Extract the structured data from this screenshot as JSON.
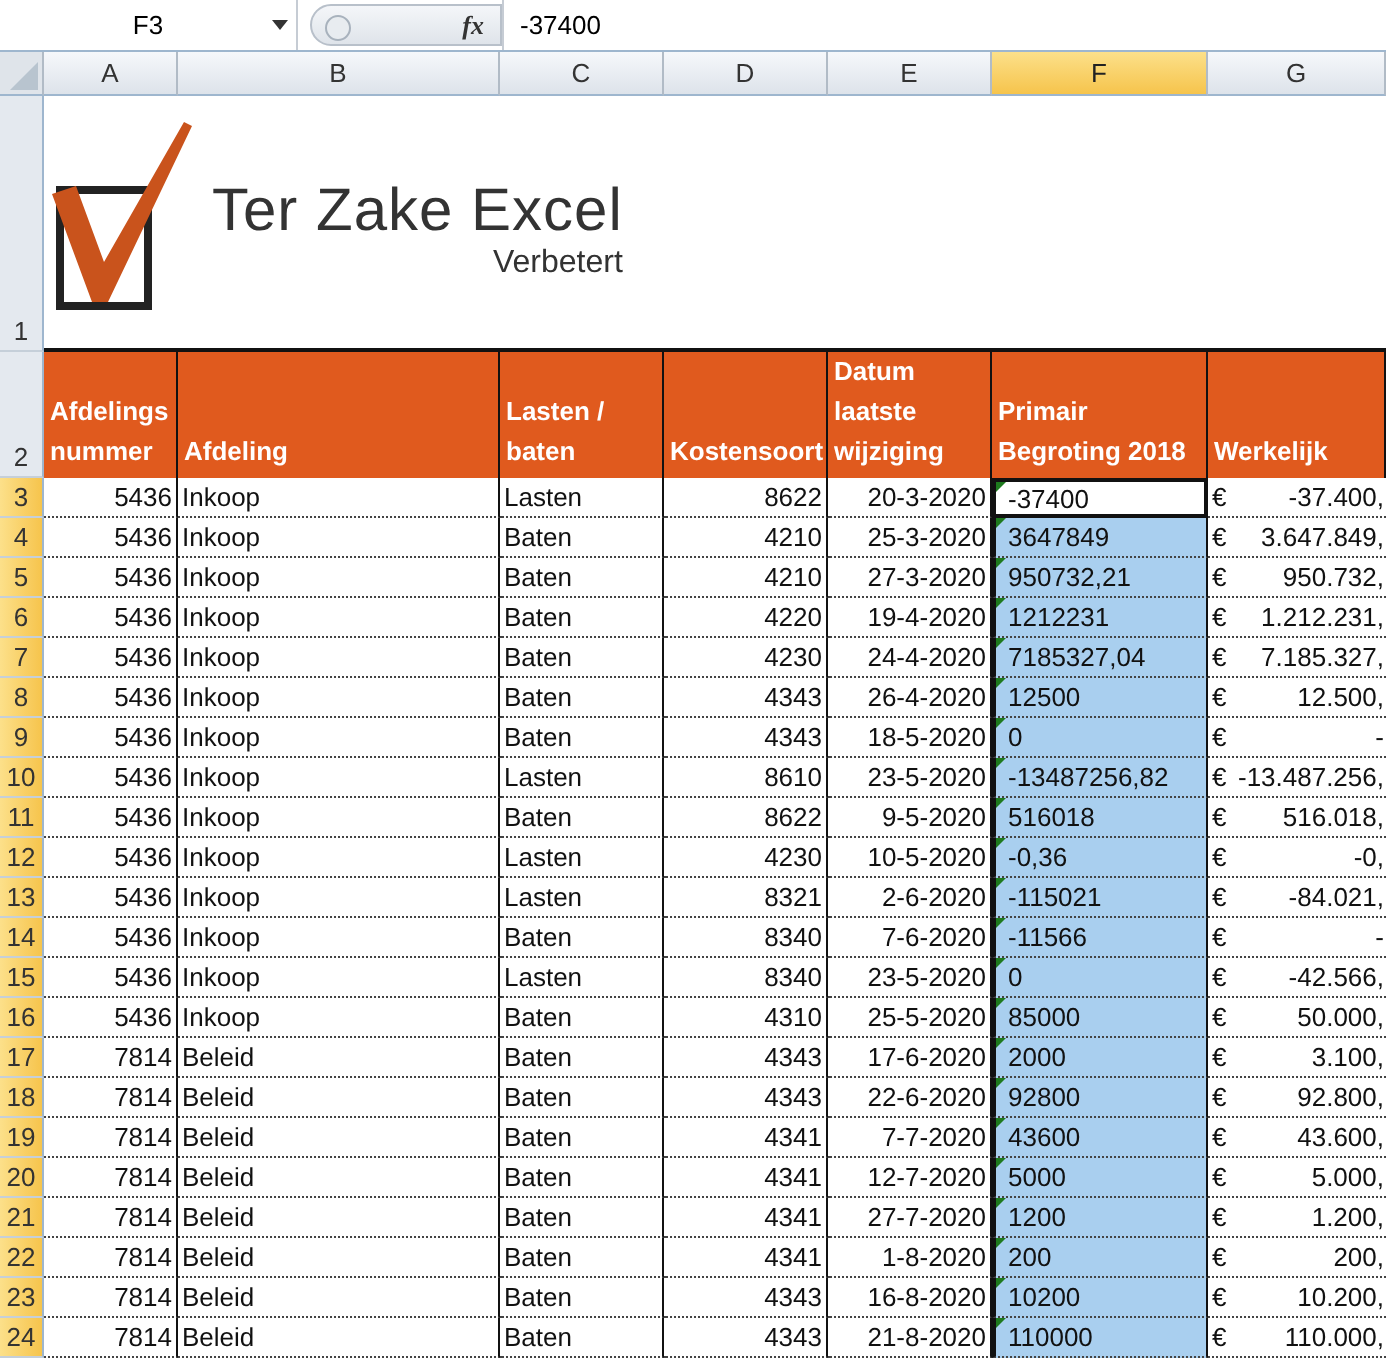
{
  "formula_bar": {
    "name_box": "F3",
    "fx": "fx",
    "formula": "-37400"
  },
  "columns": [
    {
      "label": "A",
      "selected": false
    },
    {
      "label": "B",
      "selected": false
    },
    {
      "label": "C",
      "selected": false
    },
    {
      "label": "D",
      "selected": false
    },
    {
      "label": "E",
      "selected": false
    },
    {
      "label": "F",
      "selected": true
    },
    {
      "label": "G",
      "selected": false
    }
  ],
  "logo_row": {
    "number": "1",
    "selected": false,
    "title": "Ter Zake Excel",
    "subtitle": "Verbetert"
  },
  "header_row": {
    "number": "2",
    "selected": false,
    "cells": [
      "Afdelings nummer",
      "Afdeling",
      "Lasten / baten",
      "Kostensoort",
      "Datum laatste wijziging",
      "Primair Begroting 2018",
      "Werkelijk"
    ]
  },
  "rows": [
    {
      "number": "3",
      "selected": true,
      "active": true,
      "cells": [
        "5436",
        "Inkoop",
        "Lasten",
        "8622",
        "20-3-2020",
        "-37400"
      ],
      "currency": "€",
      "amount": "-37.400,"
    },
    {
      "number": "4",
      "selected": true,
      "active": false,
      "cells": [
        "5436",
        "Inkoop",
        "Baten",
        "4210",
        "25-3-2020",
        "3647849"
      ],
      "currency": "€",
      "amount": "3.647.849,"
    },
    {
      "number": "5",
      "selected": true,
      "active": false,
      "cells": [
        "5436",
        "Inkoop",
        "Baten",
        "4210",
        "27-3-2020",
        "950732,21"
      ],
      "currency": "€",
      "amount": "950.732,"
    },
    {
      "number": "6",
      "selected": true,
      "active": false,
      "cells": [
        "5436",
        "Inkoop",
        "Baten",
        "4220",
        "19-4-2020",
        "1212231"
      ],
      "currency": "€",
      "amount": "1.212.231,"
    },
    {
      "number": "7",
      "selected": true,
      "active": false,
      "cells": [
        "5436",
        "Inkoop",
        "Baten",
        "4230",
        "24-4-2020",
        "7185327,04"
      ],
      "currency": "€",
      "amount": "7.185.327,"
    },
    {
      "number": "8",
      "selected": true,
      "active": false,
      "cells": [
        "5436",
        "Inkoop",
        "Baten",
        "4343",
        "26-4-2020",
        "12500"
      ],
      "currency": "€",
      "amount": "12.500,"
    },
    {
      "number": "9",
      "selected": true,
      "active": false,
      "cells": [
        "5436",
        "Inkoop",
        "Baten",
        "4343",
        "18-5-2020",
        "0"
      ],
      "currency": "€",
      "amount": "-"
    },
    {
      "number": "10",
      "selected": true,
      "active": false,
      "cells": [
        "5436",
        "Inkoop",
        "Lasten",
        "8610",
        "23-5-2020",
        "-13487256,82"
      ],
      "currency": "€",
      "amount": "-13.487.256,"
    },
    {
      "number": "11",
      "selected": true,
      "active": false,
      "cells": [
        "5436",
        "Inkoop",
        "Baten",
        "8622",
        "9-5-2020",
        "516018"
      ],
      "currency": "€",
      "amount": "516.018,"
    },
    {
      "number": "12",
      "selected": true,
      "active": false,
      "cells": [
        "5436",
        "Inkoop",
        "Lasten",
        "4230",
        "10-5-2020",
        "-0,36"
      ],
      "currency": "€",
      "amount": "-0,"
    },
    {
      "number": "13",
      "selected": true,
      "active": false,
      "cells": [
        "5436",
        "Inkoop",
        "Lasten",
        "8321",
        "2-6-2020",
        "-115021"
      ],
      "currency": "€",
      "amount": "-84.021,"
    },
    {
      "number": "14",
      "selected": true,
      "active": false,
      "cells": [
        "5436",
        "Inkoop",
        "Baten",
        "8340",
        "7-6-2020",
        "-11566"
      ],
      "currency": "€",
      "amount": "-"
    },
    {
      "number": "15",
      "selected": true,
      "active": false,
      "cells": [
        "5436",
        "Inkoop",
        "Lasten",
        "8340",
        "23-5-2020",
        "0"
      ],
      "currency": "€",
      "amount": "-42.566,"
    },
    {
      "number": "16",
      "selected": true,
      "active": false,
      "cells": [
        "5436",
        "Inkoop",
        "Baten",
        "4310",
        "25-5-2020",
        "85000"
      ],
      "currency": "€",
      "amount": "50.000,"
    },
    {
      "number": "17",
      "selected": true,
      "active": false,
      "cells": [
        "7814",
        "Beleid",
        "Baten",
        "4343",
        "17-6-2020",
        "2000"
      ],
      "currency": "€",
      "amount": "3.100,"
    },
    {
      "number": "18",
      "selected": true,
      "active": false,
      "cells": [
        "7814",
        "Beleid",
        "Baten",
        "4343",
        "22-6-2020",
        "92800"
      ],
      "currency": "€",
      "amount": "92.800,"
    },
    {
      "number": "19",
      "selected": true,
      "active": false,
      "cells": [
        "7814",
        "Beleid",
        "Baten",
        "4341",
        "7-7-2020",
        "43600"
      ],
      "currency": "€",
      "amount": "43.600,"
    },
    {
      "number": "20",
      "selected": true,
      "active": false,
      "cells": [
        "7814",
        "Beleid",
        "Baten",
        "4341",
        "12-7-2020",
        "5000"
      ],
      "currency": "€",
      "amount": "5.000,"
    },
    {
      "number": "21",
      "selected": true,
      "active": false,
      "cells": [
        "7814",
        "Beleid",
        "Baten",
        "4341",
        "27-7-2020",
        "1200"
      ],
      "currency": "€",
      "amount": "1.200,"
    },
    {
      "number": "22",
      "selected": true,
      "active": false,
      "cells": [
        "7814",
        "Beleid",
        "Baten",
        "4341",
        "1-8-2020",
        "200"
      ],
      "currency": "€",
      "amount": "200,"
    },
    {
      "number": "23",
      "selected": true,
      "active": false,
      "cells": [
        "7814",
        "Beleid",
        "Baten",
        "4343",
        "16-8-2020",
        "10200"
      ],
      "currency": "€",
      "amount": "10.200,"
    },
    {
      "number": "24",
      "selected": true,
      "active": false,
      "cells": [
        "7814",
        "Beleid",
        "Baten",
        "4343",
        "21-8-2020",
        "110000"
      ],
      "currency": "€",
      "amount": "110.000,"
    }
  ]
}
